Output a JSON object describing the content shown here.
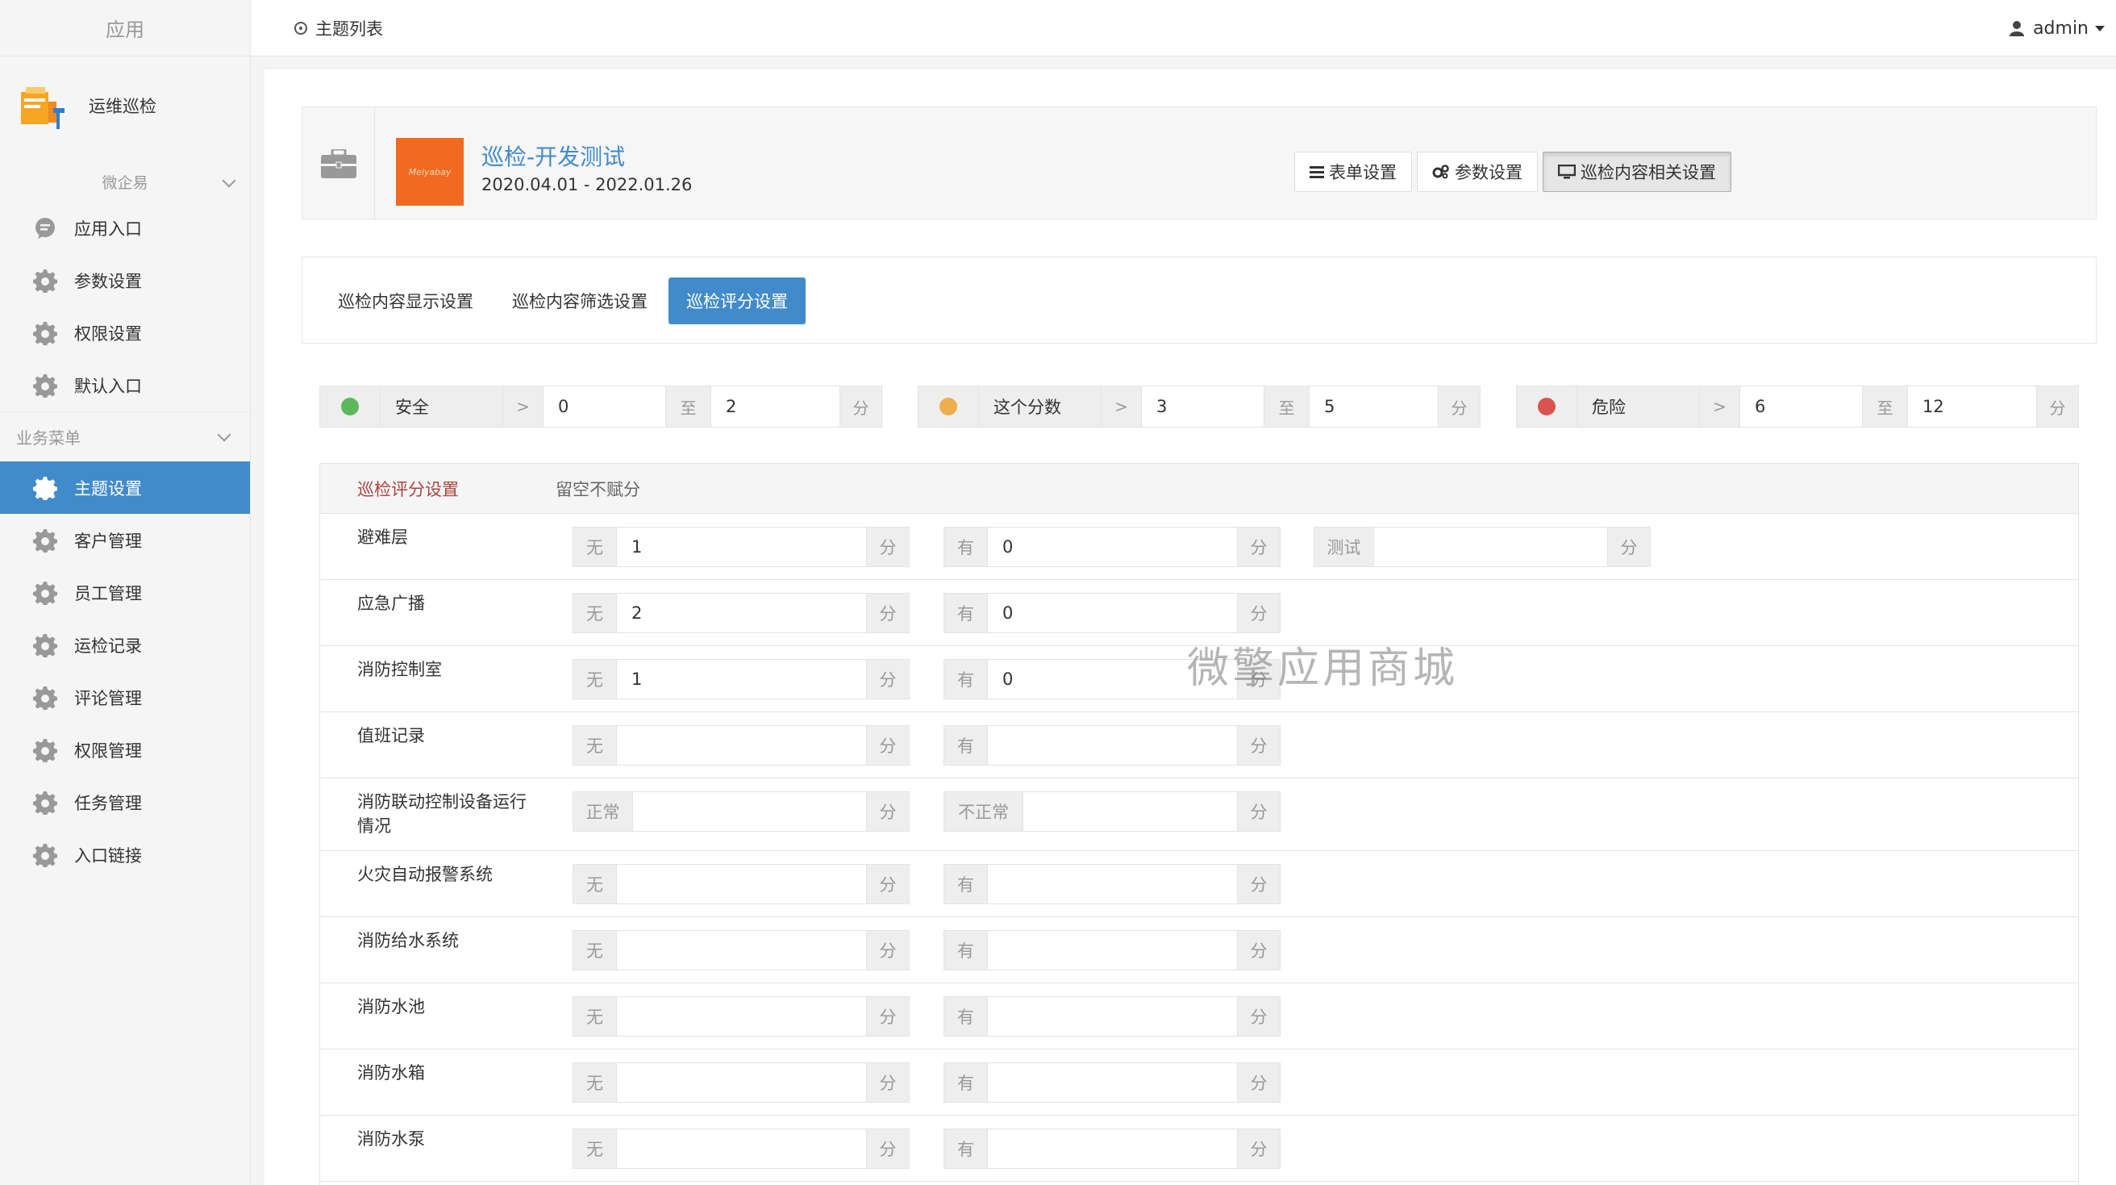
{
  "sidebar": {
    "title": "应用",
    "app_name": "运维巡检",
    "section_label": "微企易",
    "items_top": [
      "应用入口",
      "参数设置",
      "权限设置",
      "默认入口"
    ],
    "group_label": "业务菜单",
    "items_business": [
      "主题设置",
      "客户管理",
      "员工管理",
      "运检记录",
      "评论管理",
      "权限管理",
      "任务管理",
      "入口链接"
    ]
  },
  "topbar": {
    "breadcrumb": "主题列表",
    "user": "admin"
  },
  "header": {
    "title": "巡检-开发测试",
    "date_range": "2020.04.01 - 2022.01.26",
    "thumb_text": "Meiyabay",
    "buttons": [
      "表单设置",
      "参数设置",
      "巡检内容相关设置"
    ]
  },
  "tabs": [
    "巡检内容显示设置",
    "巡检内容筛选设置",
    "巡检评分设置"
  ],
  "ranges": [
    {
      "color": "#5cb85c",
      "name": "安全",
      "gt": ">",
      "from": "0",
      "to_label": "至",
      "to": "2",
      "unit": "分"
    },
    {
      "color": "#f0ad4e",
      "name": "这个分数",
      "gt": ">",
      "from": "3",
      "to_label": "至",
      "to": "5",
      "unit": "分"
    },
    {
      "color": "#d9534f",
      "name": "危险",
      "gt": ">",
      "from": "6",
      "to_label": "至",
      "to": "12",
      "unit": "分"
    }
  ],
  "score": {
    "header_title": "巡检评分设置",
    "header_hint": "留空不赋分",
    "unit": "分",
    "rows": [
      {
        "label": "避难层",
        "g1": {
          "addon": "无",
          "value": "1"
        },
        "g2": {
          "addon": "有",
          "value": "0"
        },
        "g3": {
          "addon": "测试",
          "value": ""
        }
      },
      {
        "label": "应急广播",
        "g1": {
          "addon": "无",
          "value": "2"
        },
        "g2": {
          "addon": "有",
          "value": "0"
        }
      },
      {
        "label": "消防控制室",
        "g1": {
          "addon": "无",
          "value": "1"
        },
        "g2": {
          "addon": "有",
          "value": "0"
        }
      },
      {
        "label": "值班记录",
        "g1": {
          "addon": "无",
          "value": ""
        },
        "g2": {
          "addon": "有",
          "value": ""
        }
      },
      {
        "label": "消防联动控制设备运行情况",
        "g1": {
          "addon": "正常",
          "value": ""
        },
        "g2": {
          "addon": "不正常",
          "value": ""
        }
      },
      {
        "label": "火灾自动报警系统",
        "g1": {
          "addon": "无",
          "value": ""
        },
        "g2": {
          "addon": "有",
          "value": ""
        }
      },
      {
        "label": "消防给水系统",
        "g1": {
          "addon": "无",
          "value": ""
        },
        "g2": {
          "addon": "有",
          "value": ""
        }
      },
      {
        "label": "消防水池",
        "g1": {
          "addon": "无",
          "value": ""
        },
        "g2": {
          "addon": "有",
          "value": ""
        }
      },
      {
        "label": "消防水箱",
        "g1": {
          "addon": "无",
          "value": ""
        },
        "g2": {
          "addon": "有",
          "value": ""
        }
      },
      {
        "label": "消防水泵",
        "g1": {
          "addon": "无",
          "value": ""
        },
        "g2": {
          "addon": "有",
          "value": ""
        }
      }
    ]
  },
  "watermark": "微擎应用商城",
  "colors": {
    "primary": "#428bca",
    "title_red": "#a94442"
  },
  "icons": {
    "gear": "gear-icon",
    "chat": "chat-icon",
    "user": "user-icon",
    "briefcase": "briefcase-icon",
    "list": "list-icon",
    "cogs": "cogs-icon",
    "monitor": "monitor-icon"
  }
}
